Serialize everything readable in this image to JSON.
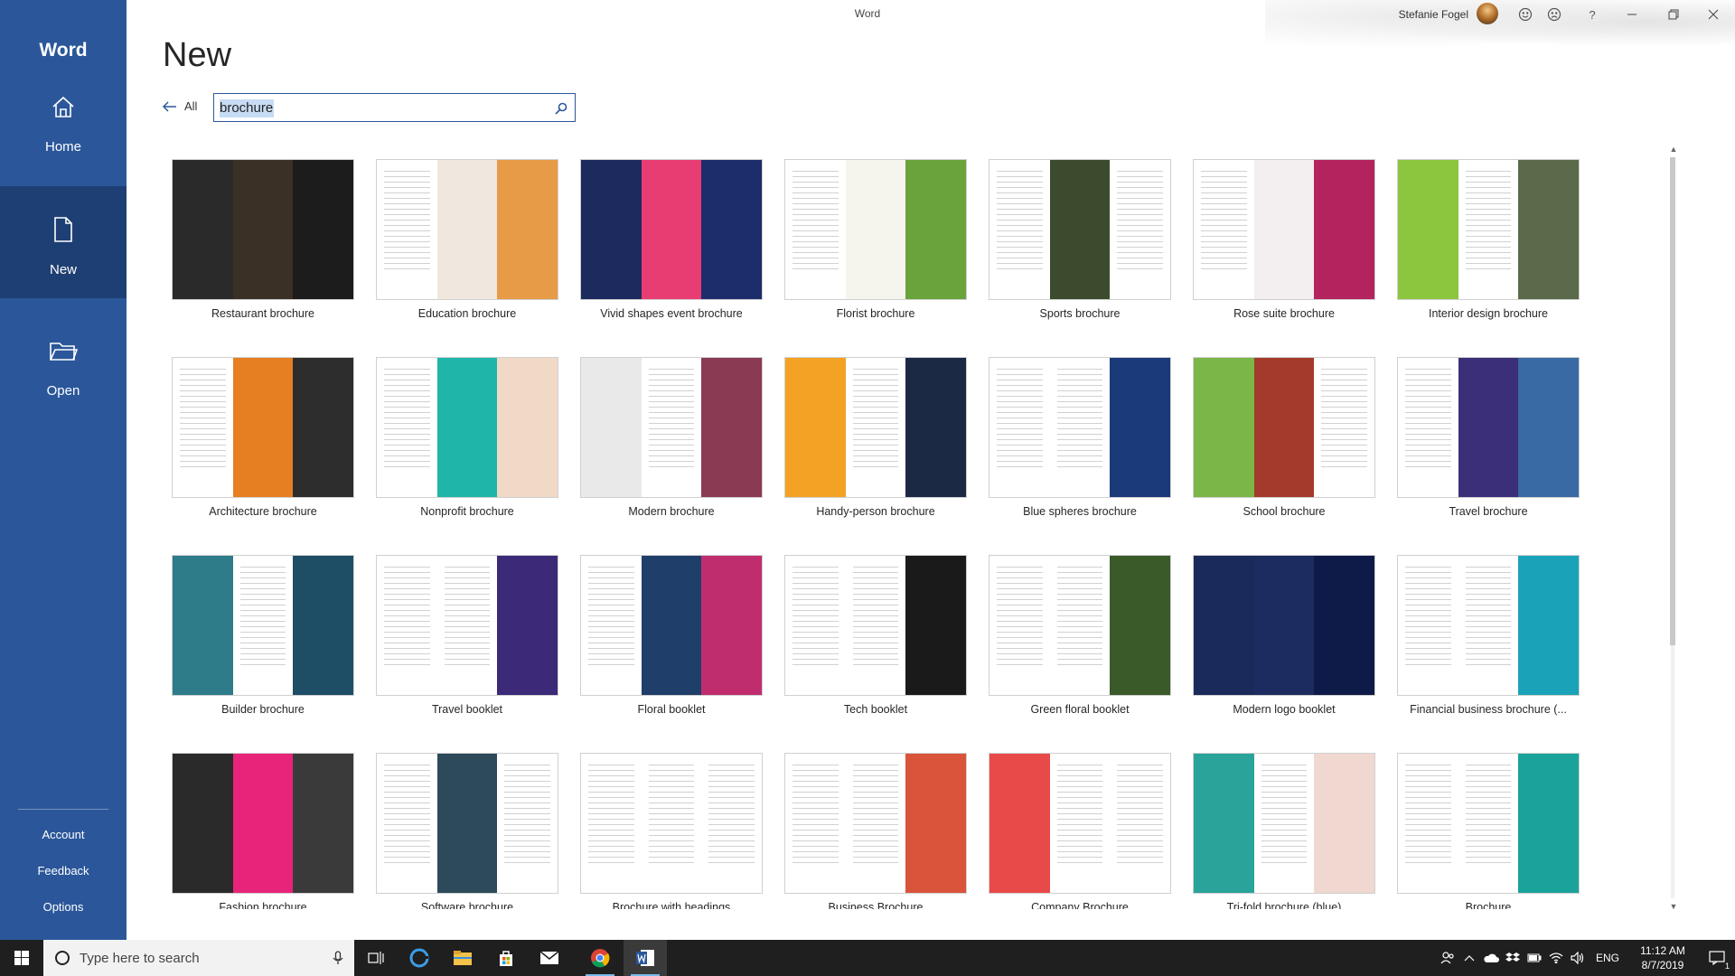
{
  "app": {
    "title": "Word",
    "user": "Stefanie Fogel",
    "help": "?"
  },
  "rail": {
    "brand": "Word",
    "items": [
      {
        "label": "Home",
        "icon": "home-icon"
      },
      {
        "label": "New",
        "icon": "new-document-icon",
        "active": true
      },
      {
        "label": "Open",
        "icon": "folder-open-icon"
      }
    ],
    "links": [
      "Account",
      "Feedback",
      "Options"
    ]
  },
  "main": {
    "title": "New",
    "back_label": "All",
    "search_value": "brochure"
  },
  "templates": [
    {
      "name": "Restaurant brochure",
      "colors": [
        "#2a2a2a",
        "#3a3026",
        "#1c1c1c"
      ]
    },
    {
      "name": "Education brochure",
      "colors": [
        "#ffffff",
        "#f0e7de",
        "#e79b47"
      ]
    },
    {
      "name": "Vivid shapes event brochure",
      "colors": [
        "#1c2a5e",
        "#e83d73",
        "#1d2d6b"
      ]
    },
    {
      "name": "Florist brochure",
      "colors": [
        "#ffffff",
        "#f5f5ee",
        "#6aa33b"
      ]
    },
    {
      "name": "Sports brochure",
      "colors": [
        "#ffffff",
        "#3c4b2e",
        "#ffffff"
      ]
    },
    {
      "name": "Rose suite brochure",
      "colors": [
        "#ffffff",
        "#f3eef0",
        "#b3245e"
      ]
    },
    {
      "name": "Interior design brochure",
      "colors": [
        "#8cc63f",
        "#ffffff",
        "#5a6a4a"
      ]
    },
    {
      "name": "Architecture brochure",
      "colors": [
        "#ffffff",
        "#e67e22",
        "#2d2d2d"
      ]
    },
    {
      "name": "Nonprofit brochure",
      "colors": [
        "#ffffff",
        "#1fb5a8",
        "#f1d9c8"
      ]
    },
    {
      "name": "Modern brochure",
      "colors": [
        "#e9e9e9",
        "#ffffff",
        "#8a3a52"
      ]
    },
    {
      "name": "Handy-person brochure",
      "colors": [
        "#f4a223",
        "#ffffff",
        "#1b2944"
      ]
    },
    {
      "name": "Blue spheres brochure",
      "colors": [
        "#ffffff",
        "#ffffff",
        "#1a3a7a"
      ]
    },
    {
      "name": "School brochure",
      "colors": [
        "#7ab648",
        "#a33a2b",
        "#ffffff"
      ]
    },
    {
      "name": "Travel brochure",
      "colors": [
        "#ffffff",
        "#3b2f7a",
        "#3a6aa3"
      ]
    },
    {
      "name": "Builder brochure",
      "colors": [
        "#2e7b8a",
        "#ffffff",
        "#1d4e66"
      ]
    },
    {
      "name": "Travel booklet",
      "colors": [
        "#ffffff",
        "#ffffff",
        "#3c2a78"
      ]
    },
    {
      "name": "Floral booklet",
      "colors": [
        "#ffffff",
        "#1f3f6a",
        "#c02d6e"
      ]
    },
    {
      "name": "Tech booklet",
      "colors": [
        "#ffffff",
        "#ffffff",
        "#1a1a1a"
      ]
    },
    {
      "name": "Green floral booklet",
      "colors": [
        "#ffffff",
        "#ffffff",
        "#3a5a2a"
      ]
    },
    {
      "name": "Modern logo booklet",
      "colors": [
        "#1a2a5a",
        "#1c2c60",
        "#0e1a48"
      ]
    },
    {
      "name": "Financial business brochure (...",
      "colors": [
        "#ffffff",
        "#ffffff",
        "#1aa3b8"
      ]
    },
    {
      "name": "Fashion brochure",
      "colors": [
        "#2a2a2a",
        "#e8247a",
        "#3a3a3a"
      ]
    },
    {
      "name": "Software brochure",
      "colors": [
        "#ffffff",
        "#2d4a5a",
        "#ffffff"
      ]
    },
    {
      "name": "Brochure with headings",
      "colors": [
        "#ffffff",
        "#ffffff",
        "#ffffff"
      ]
    },
    {
      "name": "Business Brochure",
      "colors": [
        "#ffffff",
        "#ffffff",
        "#d9543a"
      ]
    },
    {
      "name": "Company Brochure",
      "colors": [
        "#e84a4a",
        "#ffffff",
        "#ffffff"
      ]
    },
    {
      "name": "Tri-fold brochure (blue)",
      "colors": [
        "#2aa39a",
        "#ffffff",
        "#f0d8d0"
      ]
    },
    {
      "name": "Brochure",
      "colors": [
        "#ffffff",
        "#ffffff",
        "#1aa39a"
      ]
    }
  ],
  "taskbar": {
    "search_placeholder": "Type here to search",
    "language": "ENG",
    "time": "11:12 AM",
    "date": "8/7/2019",
    "notification_count": "1"
  },
  "accent_color": "#2b579a"
}
